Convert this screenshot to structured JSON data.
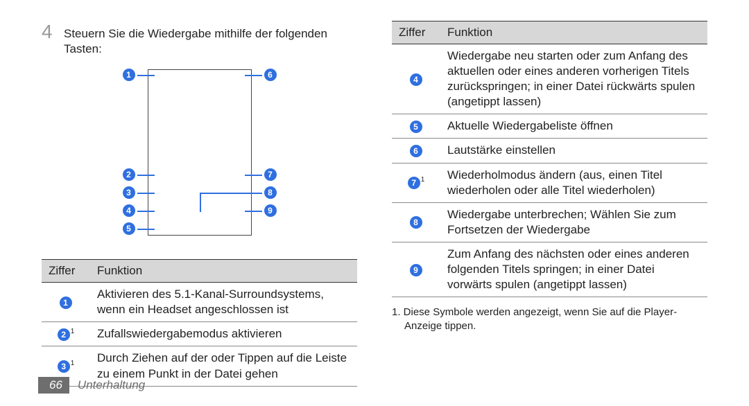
{
  "step": {
    "number": "4",
    "text": "Steuern Sie die Wiedergabe mithilfe der folgenden Tasten:"
  },
  "diagram": {
    "labels": [
      "1",
      "2",
      "3",
      "4",
      "5",
      "6",
      "7",
      "8",
      "9"
    ]
  },
  "table_left": {
    "headers": {
      "c1": "Ziffer",
      "c2": "Funktion"
    },
    "rows": [
      {
        "num": "1",
        "sup": "",
        "text": "Aktivieren des 5.1-Kanal-Surroundsystems, wenn ein Headset angeschlossen ist"
      },
      {
        "num": "2",
        "sup": "1",
        "text": "Zufallswiedergabemodus aktivieren"
      },
      {
        "num": "3",
        "sup": "1",
        "text": "Durch Ziehen auf der oder Tippen auf die Leiste zu einem Punkt in der Datei gehen"
      }
    ]
  },
  "table_right": {
    "headers": {
      "c1": "Ziffer",
      "c2": "Funktion"
    },
    "rows": [
      {
        "num": "4",
        "sup": "",
        "text": "Wiedergabe neu starten oder zum Anfang des aktuellen oder eines anderen vorherigen Titels zurückspringen; in einer Datei rückwärts spulen (angetippt lassen)"
      },
      {
        "num": "5",
        "sup": "",
        "text": "Aktuelle Wiedergabeliste öffnen"
      },
      {
        "num": "6",
        "sup": "",
        "text": "Lautstärke einstellen"
      },
      {
        "num": "7",
        "sup": "1",
        "text": "Wiederholmodus ändern (aus, einen Titel wiederholen oder alle Titel wiederholen)"
      },
      {
        "num": "8",
        "sup": "",
        "text": "Wiedergabe unterbrechen; Wählen Sie zum Fortsetzen der Wiedergabe"
      },
      {
        "num": "9",
        "sup": "",
        "text": "Zum Anfang des nächsten oder eines anderen folgenden Titels springen; in einer Datei vorwärts spulen (angetippt lassen)"
      }
    ]
  },
  "footnote": "1.  Diese Symbole werden angezeigt, wenn Sie auf die Player-Anzeige tippen.",
  "footer": {
    "page": "66",
    "section": "Unterhaltung"
  }
}
